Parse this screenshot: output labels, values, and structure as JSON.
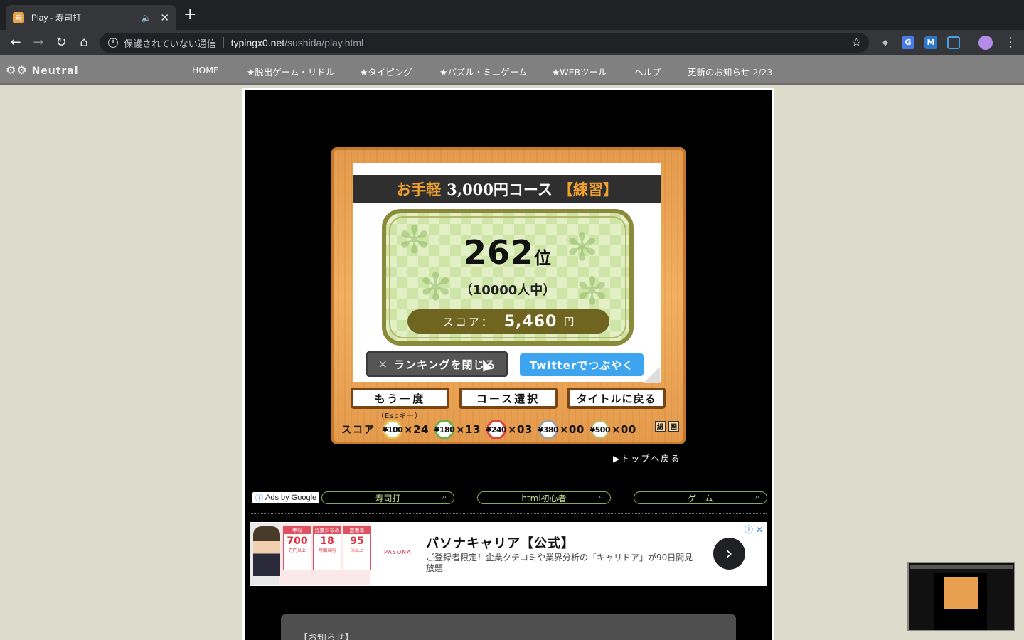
{
  "browser": {
    "tab_title": "Play - 寿司打",
    "tab_favicon": "寿",
    "security_label": "保護されていない通信",
    "url_host": "typingx0.net",
    "url_path": "/sushida/play.html",
    "extension_labels": [
      "M"
    ]
  },
  "site_nav": {
    "logo": "Neutral",
    "items": [
      {
        "label": "HOME"
      },
      {
        "label": "★脱出ゲーム・リドル"
      },
      {
        "label": "★タイピング"
      },
      {
        "label": "★パズル・ミニゲーム"
      },
      {
        "label": "★WEBツール"
      },
      {
        "label": "ヘルプ"
      }
    ],
    "news_label": "更新のお知らせ",
    "news_date": "2/23"
  },
  "game": {
    "course_prefix": "お手軽",
    "course_main": "3,000円コース",
    "course_mode": "【練習】",
    "rank_value": "262",
    "rank_unit": "位",
    "rank_total": "（10000人中）",
    "score_label": "スコア：",
    "score_value": "5,460",
    "score_unit": "円",
    "close_ranking_label": "ランキングを閉じる",
    "twitter_label": "Twitterでつぶやく",
    "retry_label": "もう一度",
    "retry_hint": "（Escキー）",
    "course_select_label": "コース選択",
    "title_back_label": "タイトルに戻る",
    "plates_label": "スコア",
    "plates": [
      {
        "price": "¥100",
        "count": "×24",
        "color": "#e8c050"
      },
      {
        "price": "¥180",
        "count": "×13",
        "color": "#6ab04c"
      },
      {
        "price": "¥240",
        "count": "×03",
        "color": "#e04040"
      },
      {
        "price": "¥380",
        "count": "×00",
        "color": "#a0a0a0"
      },
      {
        "price": "¥500",
        "count": "×00",
        "color": "#c8b060"
      }
    ],
    "mini_icons": [
      "総",
      "画"
    ],
    "back_to_top": "▶トップへ戻る"
  },
  "ads": {
    "ads_by_google": "Ads by Google",
    "search_pills": [
      "寿司打",
      "html初心者",
      "ゲーム"
    ],
    "banner": {
      "stats": [
        {
          "top": "年収",
          "value": "700",
          "sub": "万円以上"
        },
        {
          "top": "残業少なめ",
          "value": "18",
          "sub": "時間以内"
        },
        {
          "top": "定着率",
          "value": "95",
          "sub": "%以上"
        }
      ],
      "brand": "PASONA",
      "title": "パソナキャリア【公式】",
      "description": "ご登録者限定！企業クチコミや業界分析の「キャリドア」が90日間見放題"
    }
  },
  "notice": {
    "title": "【お知らせ】"
  },
  "colors": {
    "accent_orange": "#f2a030",
    "twitter_blue": "#3da5f0",
    "score_pill": "#6f6420"
  }
}
